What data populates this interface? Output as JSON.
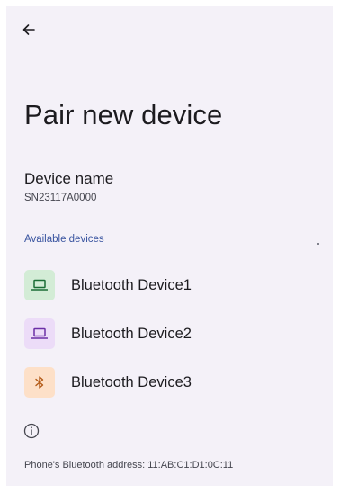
{
  "header": {
    "back_icon": "arrow-left-icon"
  },
  "page": {
    "title": "Pair new device"
  },
  "device_name": {
    "title": "Device name",
    "value": "SN23117A0000"
  },
  "available": {
    "header": "Available devices",
    "devices": [
      {
        "label": "Bluetooth Device1",
        "icon": "laptop-icon",
        "icon_bg": "#d3ecd6",
        "icon_color": "#1b6d35"
      },
      {
        "label": "Bluetooth Device2",
        "icon": "laptop-icon",
        "icon_bg": "#ecdcf8",
        "icon_color": "#6b2fa6"
      },
      {
        "label": "Bluetooth Device3",
        "icon": "bluetooth-icon",
        "icon_bg": "#fde0c8",
        "icon_color": "#b35a17"
      }
    ]
  },
  "footer": {
    "info_icon": "info-icon",
    "address": "Phone's Bluetooth address: 11:AB:C1:D1:0C:11"
  },
  "colors": {
    "background": "#f4f1f8",
    "accent": "#3a55a0",
    "text_primary": "#1c1b1f",
    "text_secondary": "#45464f"
  }
}
